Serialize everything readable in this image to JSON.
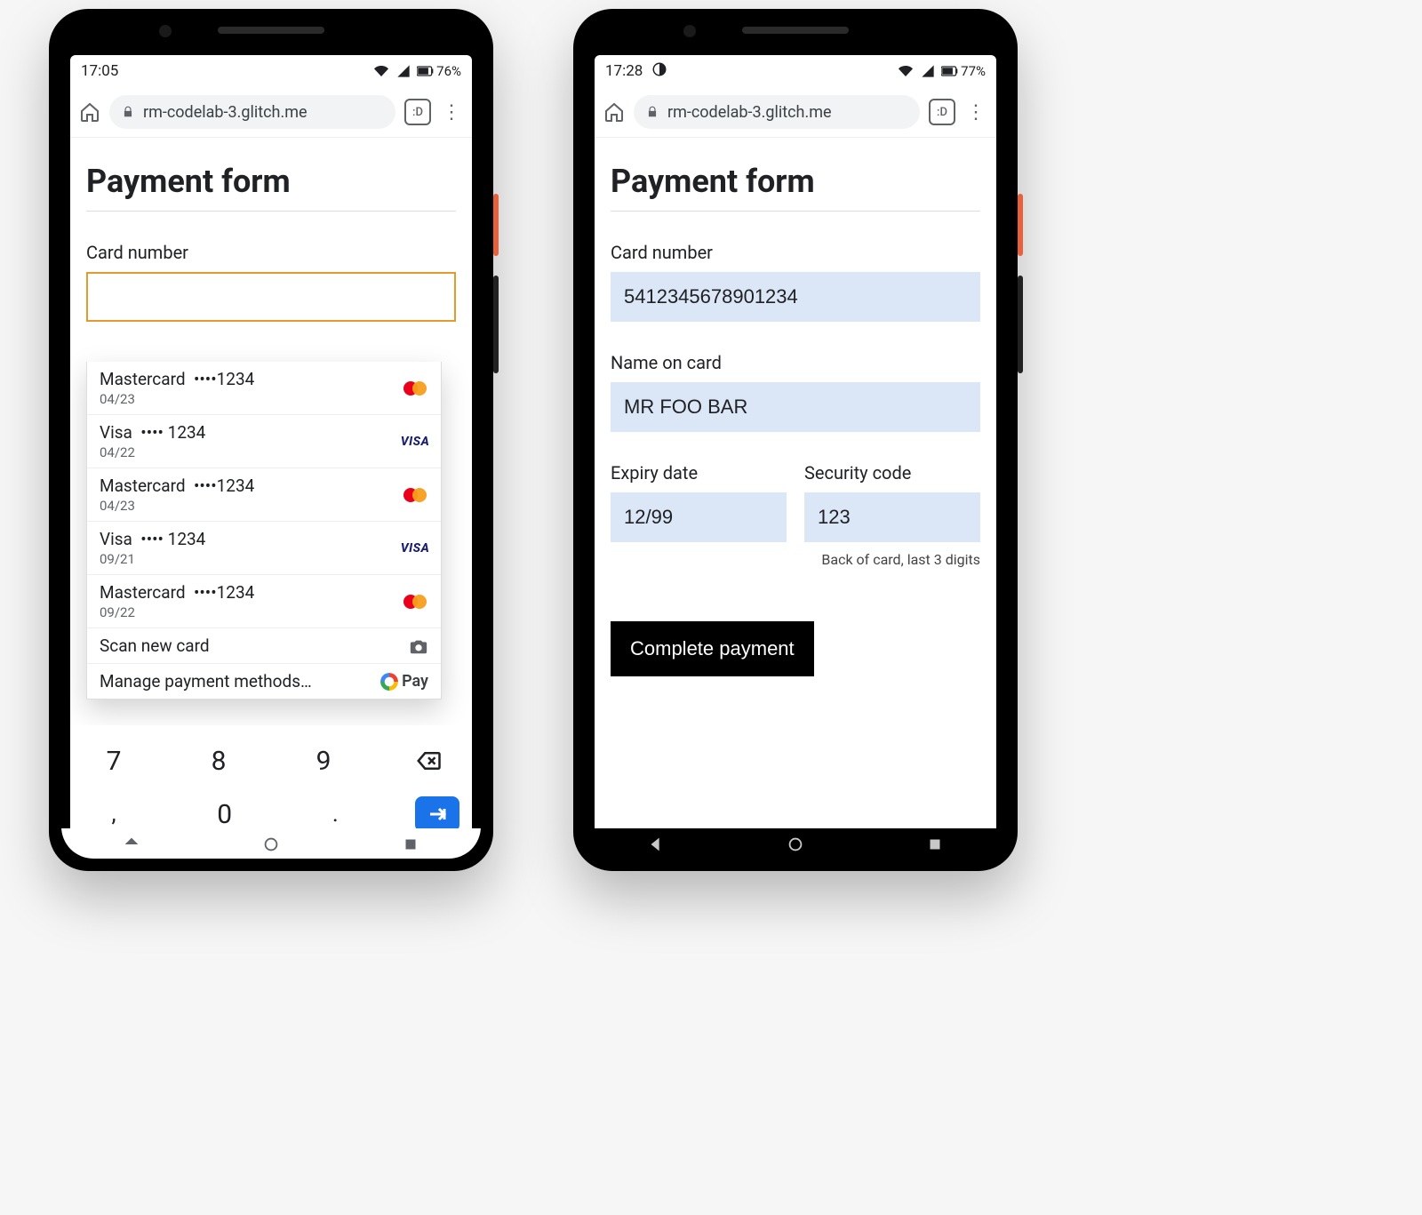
{
  "left": {
    "statusbar": {
      "time": "17:05",
      "battery_pct": "76%"
    },
    "omnibar": {
      "url": "rm-codelab-3.glitch.me",
      "tab_count": ":D"
    },
    "page": {
      "title": "Payment form",
      "card_number_label": "Card number",
      "card_number_value": ""
    },
    "autofill": {
      "cards": [
        {
          "brand": "Mastercard",
          "mask": "••••1234",
          "exp": "04/23",
          "type": "mc"
        },
        {
          "brand": "Visa",
          "mask": "•••• 1234",
          "exp": "04/22",
          "type": "visa"
        },
        {
          "brand": "Mastercard",
          "mask": "••••1234",
          "exp": "04/23",
          "type": "mc"
        },
        {
          "brand": "Visa",
          "mask": "•••• 1234",
          "exp": "09/21",
          "type": "visa"
        },
        {
          "brand": "Mastercard",
          "mask": "••••1234",
          "exp": "09/22",
          "type": "mc"
        }
      ],
      "scan_label": "Scan new card",
      "manage_label": "Manage payment methods…",
      "gpay_label": "Pay"
    },
    "keyboard": {
      "row1": [
        "7",
        "8",
        "9"
      ],
      "row2": [
        ",",
        "0",
        "."
      ]
    }
  },
  "right": {
    "statusbar": {
      "time": "17:28",
      "battery_pct": "77%"
    },
    "omnibar": {
      "url": "rm-codelab-3.glitch.me",
      "tab_count": ":D"
    },
    "page": {
      "title": "Payment form",
      "card_number_label": "Card number",
      "card_number_value": "5412345678901234",
      "name_label": "Name on card",
      "name_value": "MR FOO BAR",
      "expiry_label": "Expiry date",
      "expiry_value": "12/99",
      "cvc_label": "Security code",
      "cvc_value": "123",
      "cvc_hint": "Back of card, last 3 digits",
      "submit_label": "Complete payment"
    }
  }
}
